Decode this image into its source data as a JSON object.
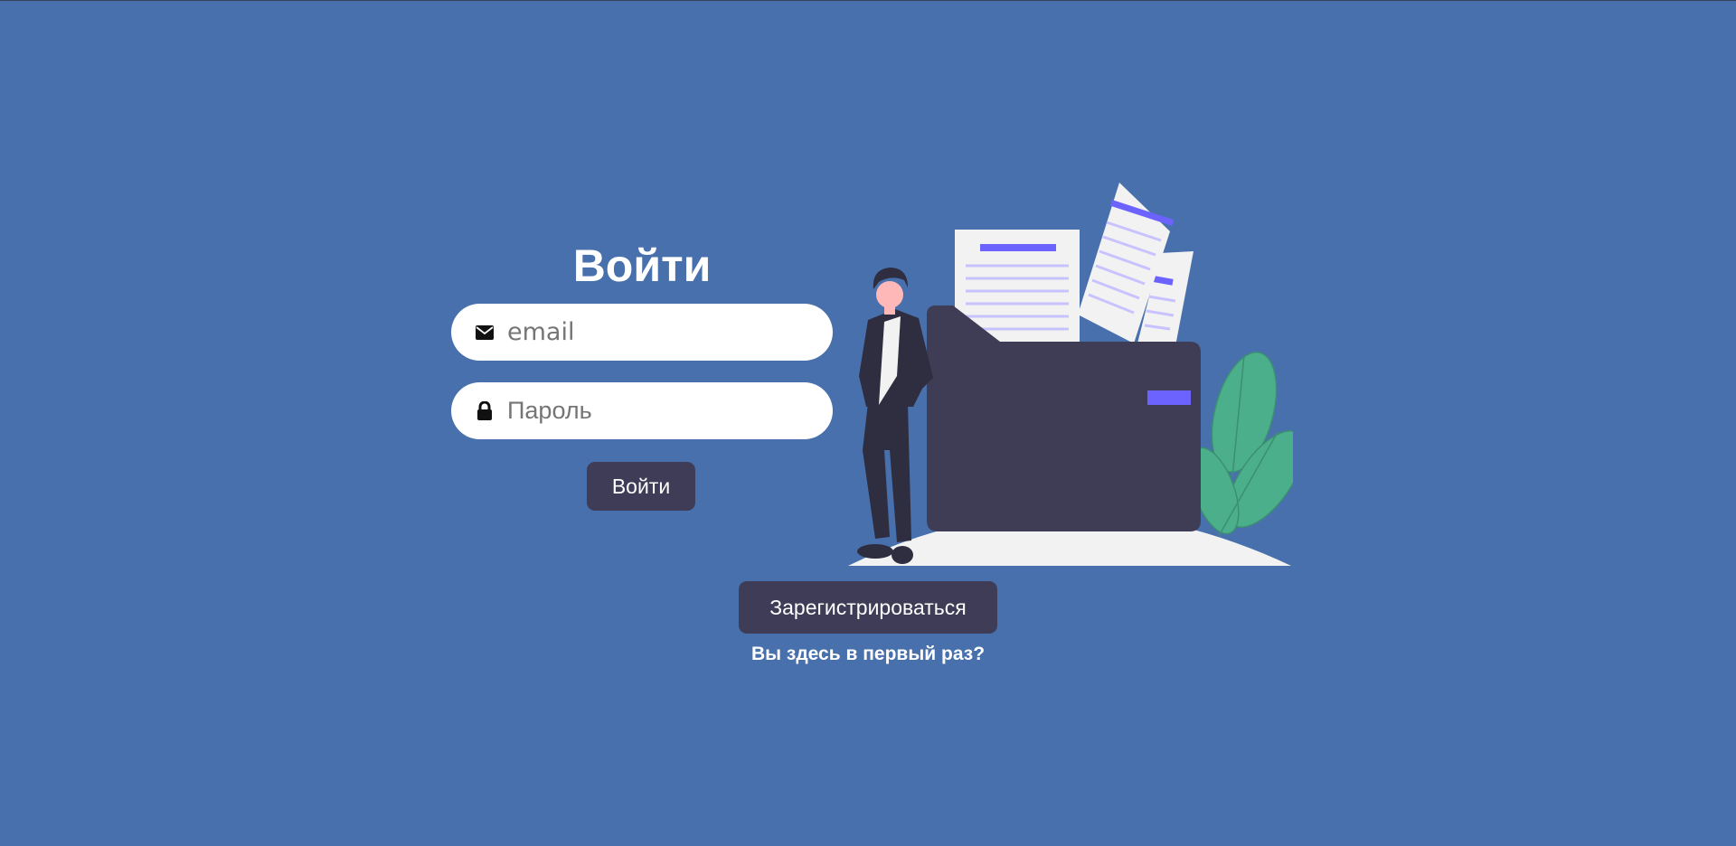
{
  "login": {
    "title": "Войти",
    "email_placeholder": "email",
    "password_placeholder": "Пароль",
    "submit_label": "Войти"
  },
  "register": {
    "button_label": "Зарегистрироваться",
    "hint": "Вы здесь в первый раз?"
  },
  "icons": {
    "email": "envelope-icon",
    "password": "lock-icon"
  },
  "colors": {
    "background": "#4870ad",
    "button": "#3e3c57",
    "accent": "#6c63ff",
    "plant": "#4caf8c"
  }
}
